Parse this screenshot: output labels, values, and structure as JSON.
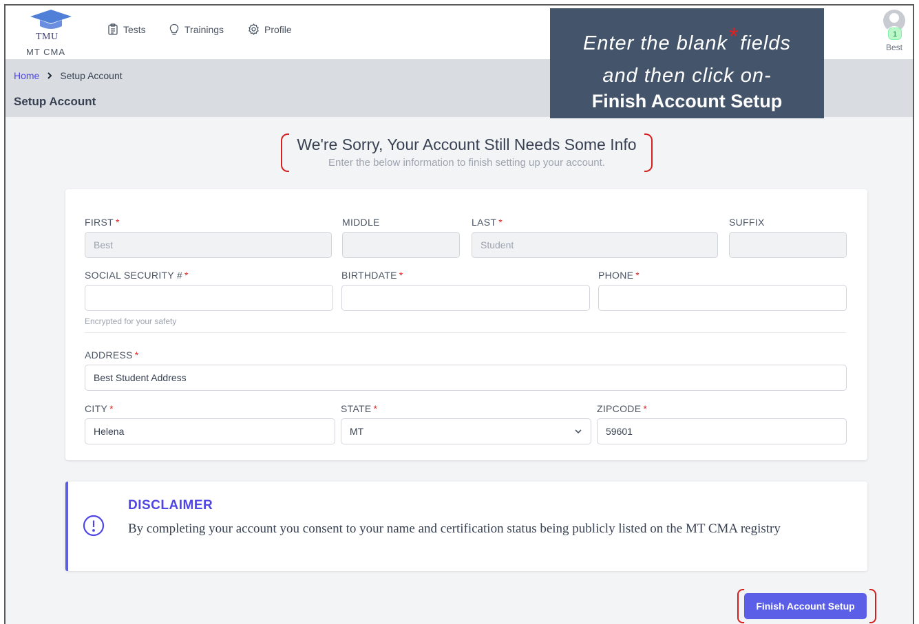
{
  "brand": {
    "logo_text": "TMU",
    "subtitle": "MT CMA"
  },
  "nav": {
    "tests": "Tests",
    "trainings": "Trainings",
    "profile": "Profile"
  },
  "user": {
    "name": "Best",
    "notification_count": "1"
  },
  "breadcrumb": {
    "home": "Home",
    "current": "Setup Account"
  },
  "page_title": "Setup Account",
  "callout": {
    "line1_a": "Enter the blank",
    "star": "*",
    "line1_b": "fields",
    "line2": "and then click on-",
    "line3": "Finish Account Setup"
  },
  "heading": {
    "title": "We're Sorry, Your Account Still Needs Some Info",
    "subtitle": "Enter the below information to finish setting up your account."
  },
  "form": {
    "required_mark": "*",
    "first": {
      "label": "FIRST",
      "value": "Best"
    },
    "middle": {
      "label": "MIDDLE",
      "value": ""
    },
    "last": {
      "label": "LAST",
      "value": "Student"
    },
    "suffix": {
      "label": "SUFFIX",
      "value": ""
    },
    "ssn": {
      "label": "SOCIAL SECURITY #",
      "value": "",
      "hint": "Encrypted for your safety"
    },
    "birthdate": {
      "label": "BIRTHDATE",
      "value": ""
    },
    "phone": {
      "label": "PHONE",
      "value": ""
    },
    "address": {
      "label": "ADDRESS",
      "value": "Best Student Address"
    },
    "city": {
      "label": "CITY",
      "value": "Helena"
    },
    "state": {
      "label": "STATE",
      "value": "MT"
    },
    "zipcode": {
      "label": "ZIPCODE",
      "value": "59601"
    }
  },
  "disclaimer": {
    "title": "DISCLAIMER",
    "text": "By completing your account you consent to your name and certification status being publicly listed on the MT CMA registry"
  },
  "actions": {
    "finish": "Finish Account Setup"
  },
  "colors": {
    "accent": "#5b5fe8",
    "required": "#e02424",
    "callout_bg": "#44546a",
    "highlight": "#d61f1f"
  }
}
